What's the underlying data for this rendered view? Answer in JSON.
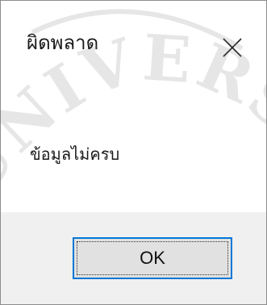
{
  "dialog": {
    "title": "ผิดพลาด",
    "message": "ข้อมูลไม่ครบ",
    "ok_label": "OK",
    "close_icon": "close-icon"
  },
  "watermark": {
    "text": "UNIVERSITY"
  },
  "colors": {
    "accent": "#0078d7",
    "footer_bg": "#f0f0f0",
    "button_bg": "#e1e1e1"
  }
}
